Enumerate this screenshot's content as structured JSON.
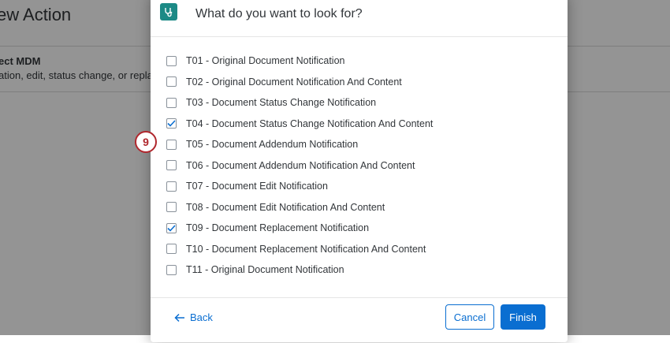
{
  "background": {
    "title": "ew Action",
    "heading": "ect MDM",
    "description": "ation, edit, status change, or replac"
  },
  "dialog": {
    "title": "What do you want to look for?",
    "icon": "stethoscope-app-icon",
    "items": [
      {
        "label": "T01 - Original Document Notification",
        "checked": false
      },
      {
        "label": "T02 - Original Document Notification And Content",
        "checked": false
      },
      {
        "label": "T03 - Document Status Change Notification",
        "checked": false
      },
      {
        "label": "T04 - Document Status Change Notification And Content",
        "checked": true
      },
      {
        "label": "T05 - Document Addendum Notification",
        "checked": false
      },
      {
        "label": "T06 - Document Addendum Notification And Content",
        "checked": false
      },
      {
        "label": "T07 - Document Edit Notification",
        "checked": false
      },
      {
        "label": "T08 - Document Edit Notification And Content",
        "checked": false
      },
      {
        "label": "T09 - Document Replacement Notification",
        "checked": true
      },
      {
        "label": "T10 - Document Replacement Notification And Content",
        "checked": false
      },
      {
        "label": "T11 - Original Document Notification",
        "checked": false
      }
    ],
    "footer": {
      "back_label": "Back",
      "cancel_label": "Cancel",
      "finish_label": "Finish"
    }
  },
  "step_badge": "9",
  "colors": {
    "accent": "#0a6ed1",
    "app_icon": "#1c8a86",
    "badge": "#b0272d"
  }
}
